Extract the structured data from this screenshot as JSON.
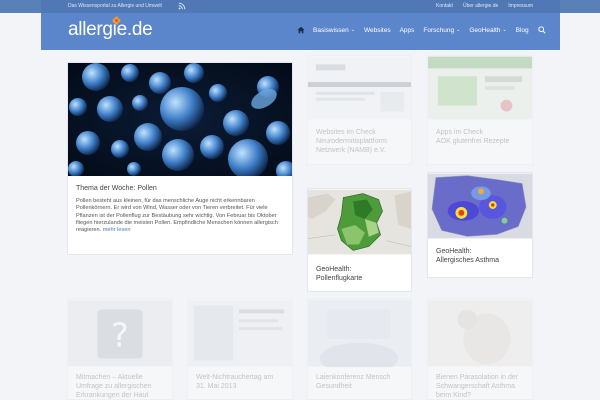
{
  "topbar": {
    "tagline": "Das Wissensportal zu Allergie und Umwelt",
    "links": [
      "Kontakt",
      "Über allergie.de",
      "Impressum"
    ]
  },
  "header": {
    "logo_text": "allergie.de",
    "nav": [
      {
        "label": "Basiswissen",
        "dropdown": true
      },
      {
        "label": "Websites",
        "dropdown": false
      },
      {
        "label": "Apps",
        "dropdown": false
      },
      {
        "label": "Forschung",
        "dropdown": true
      },
      {
        "label": "GeoHealth",
        "dropdown": true
      },
      {
        "label": "Blog",
        "dropdown": false
      }
    ]
  },
  "featured": {
    "title": "Thema der Woche: Pollen",
    "text": "Pollen besteht aus kleinen, für das menschliche Auge nicht erkennbaren Pollenkörnern. Er wird von Wind, Wasser oder von Tieren verbreitet. Für viele Pflanzen ist der Pollenflug zur Bestäubung sehr wichtig. Von Februar bis Oktober fliegen hierzulande die meisten Pollen. Empfindliche Menschen können allergisch reagieren.",
    "read_more": "mehr lesen"
  },
  "cards": {
    "vernetzt": {
      "line1": "Websites im Check",
      "line2": "Neurodermitisplattform",
      "line3": "Netzwerk (NAMB) e.V."
    },
    "apps": {
      "line1": "Apps im Check",
      "line2": "AOK glutenfrei Rezepte"
    },
    "pollenflug": {
      "line1": "GeoHealth:",
      "line2": "Pollenflugkarte"
    },
    "asthma": {
      "line1": "GeoHealth:",
      "line2": "Allergisches Asthma"
    },
    "mehr1": {
      "line1": "Mitmachen – Aktuelle",
      "line2": "Umfrage zu allergischen",
      "line3": "Erkrankungen der Haut"
    },
    "mehr2": {
      "line1": "Welt-Nichtrauchertag am",
      "line2": "31. Mai 2013"
    },
    "mehr3": {
      "line1": "Laienkonferenz Mensch",
      "line2": "Gesundheit"
    },
    "mehr4": {
      "line1": "Bienen Parasolation in der",
      "line2": "Schwangerschaft Asthma",
      "line3": "beim Kind?"
    }
  },
  "colors": {
    "topbar": "#4f78b5",
    "header": "#5b86cc",
    "accent": "#4f78b5",
    "background": "#f2f4f7"
  },
  "icons": [
    "rss-icon",
    "logo-flower-icon",
    "home-icon",
    "search-icon"
  ]
}
